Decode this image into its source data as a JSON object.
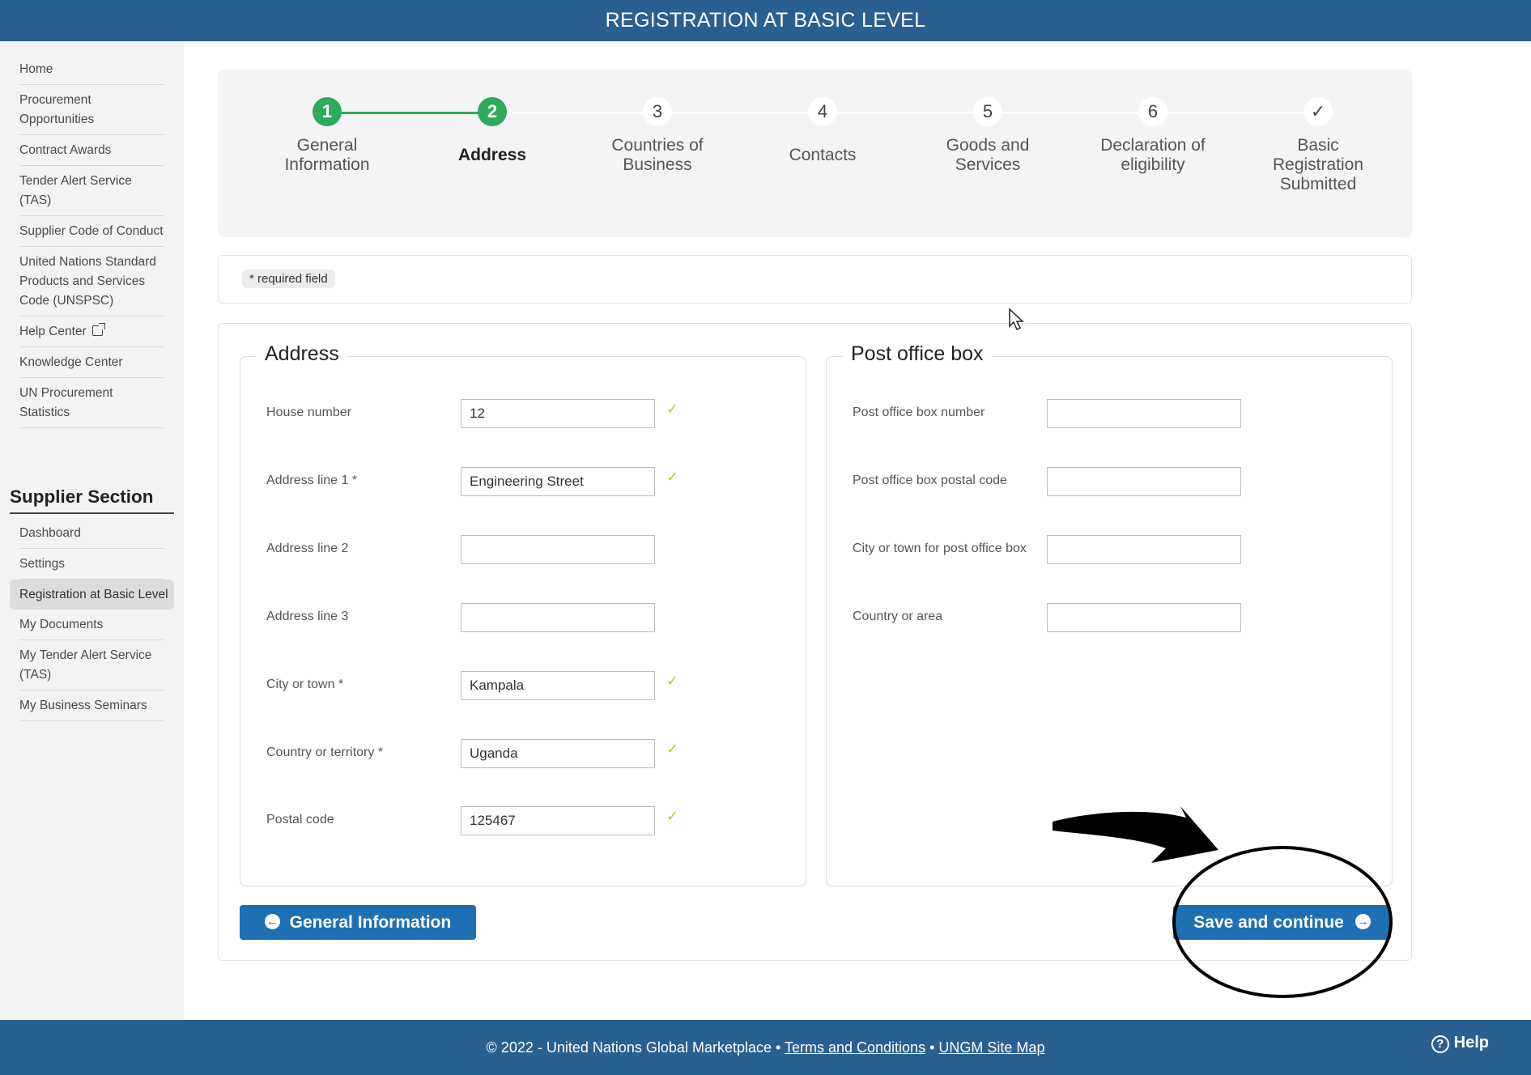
{
  "header": {
    "title": "REGISTRATION AT BASIC LEVEL"
  },
  "sidebar": {
    "items": [
      {
        "label": "Home"
      },
      {
        "label": "Procurement Opportunities"
      },
      {
        "label": "Contract Awards"
      },
      {
        "label": "Tender Alert Service (TAS)"
      },
      {
        "label": "Supplier Code of Conduct"
      },
      {
        "label": "United Nations Standard Products and Services Code (UNSPSC)"
      },
      {
        "label": "Help Center"
      },
      {
        "label": "Knowledge Center"
      },
      {
        "label": "UN Procurement Statistics"
      }
    ],
    "section_title": "Supplier Section",
    "supplier_items": [
      {
        "label": "Dashboard"
      },
      {
        "label": "Settings"
      },
      {
        "label": "Registration at Basic Level"
      },
      {
        "label": "My Documents"
      },
      {
        "label": "My Tender Alert Service (TAS)"
      },
      {
        "label": "My Business Seminars"
      }
    ]
  },
  "stepper": {
    "steps": [
      {
        "num": "1",
        "label": "General Information",
        "state": "done"
      },
      {
        "num": "2",
        "label": "Address",
        "state": "current"
      },
      {
        "num": "3",
        "label": "Countries of Business",
        "state": "todo"
      },
      {
        "num": "4",
        "label": "Contacts",
        "state": "todo"
      },
      {
        "num": "5",
        "label": "Goods and Services",
        "state": "todo"
      },
      {
        "num": "6",
        "label": "Declaration of eligibility",
        "state": "todo"
      },
      {
        "num": "✓",
        "label": "Basic Registration Submitted",
        "state": "todo"
      }
    ]
  },
  "required_note": "* required field",
  "address": {
    "title": "Address",
    "fields": [
      {
        "label": "House number",
        "value": "12",
        "valid": true
      },
      {
        "label": "Address line 1 *",
        "value": "Engineering Street",
        "valid": true
      },
      {
        "label": "Address line 2",
        "value": "",
        "valid": false
      },
      {
        "label": "Address line 3",
        "value": "",
        "valid": false
      },
      {
        "label": "City or town *",
        "value": "Kampala",
        "valid": true
      },
      {
        "label": "Country or territory *",
        "value": "Uganda",
        "valid": true
      },
      {
        "label": "Postal code",
        "value": "125467",
        "valid": true
      }
    ]
  },
  "pobox": {
    "title": "Post office box",
    "fields": [
      {
        "label": "Post office box number",
        "value": ""
      },
      {
        "label": "Post office box postal code",
        "value": ""
      },
      {
        "label": "City or town for post office box",
        "value": ""
      },
      {
        "label": "Country or area",
        "value": ""
      }
    ]
  },
  "buttons": {
    "back_label": "General Information",
    "next_label": "Save and continue"
  },
  "footer": {
    "copyright": "© 2022 - United Nations Global Marketplace •",
    "terms": "Terms and Conditions",
    "sep": "•",
    "sitemap": "UNGM Site Map",
    "help": "Help"
  },
  "colors": {
    "brand": "#2a5f91",
    "button": "#1f6fb3",
    "step_done": "#2eaa5c",
    "valid_check": "#b9c833"
  }
}
